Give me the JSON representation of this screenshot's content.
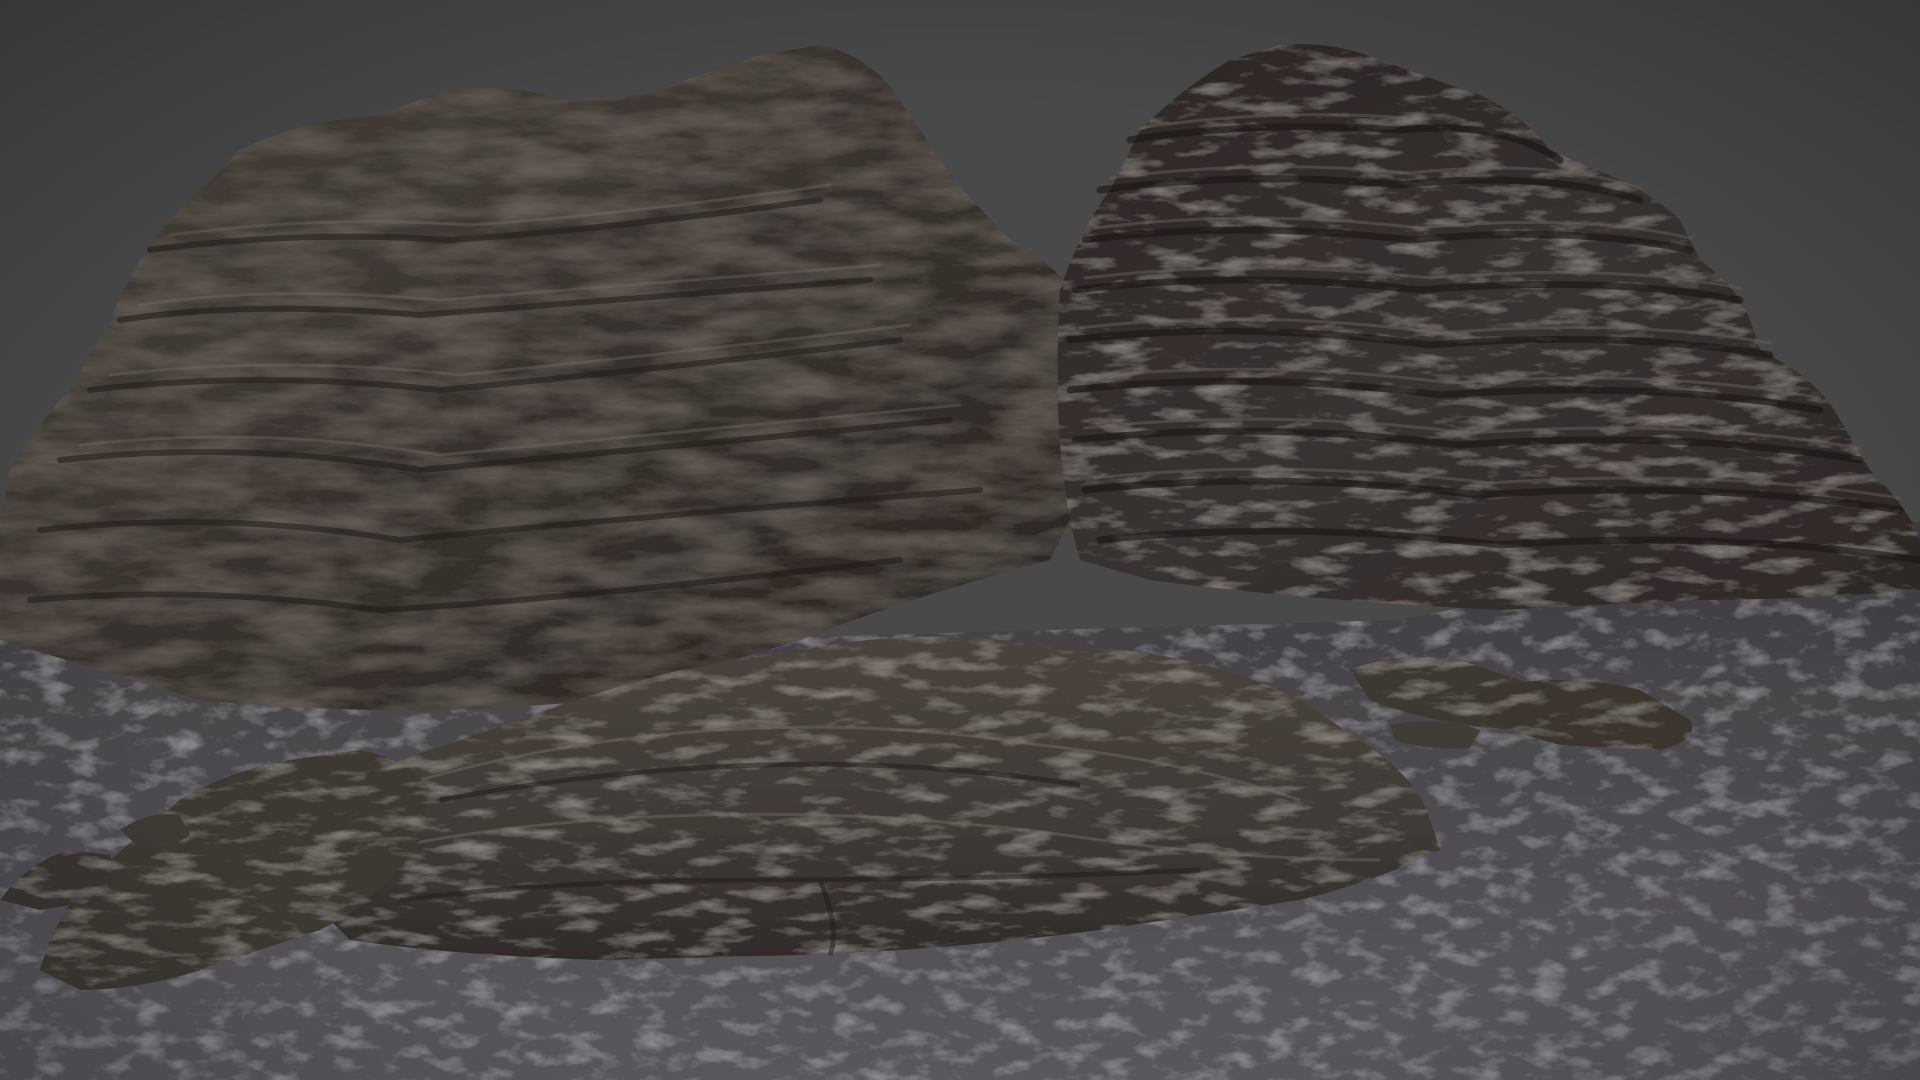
{
  "scene": {
    "colors": {
      "background": "#49494a",
      "ground_light": "#5f5d63",
      "ground_dark": "#3a3839",
      "rock_dark": "#2b2725",
      "rock_mid": "#3d3631",
      "rock_light": "#5a514a",
      "rock_highlight": "#8c8278",
      "rock_brown": "#4a3a2c"
    },
    "objects": [
      {
        "name": "left-rock-formation",
        "kind": "layered-rock"
      },
      {
        "name": "right-rock-formation",
        "kind": "layered-rock"
      },
      {
        "name": "foreground-rock-slab",
        "kind": "rock-slab"
      },
      {
        "name": "left-small-rocks",
        "kind": "rock-cluster"
      },
      {
        "name": "right-small-rocks",
        "kind": "rock-cluster"
      },
      {
        "name": "ground-plane",
        "kind": "terrain"
      }
    ]
  }
}
